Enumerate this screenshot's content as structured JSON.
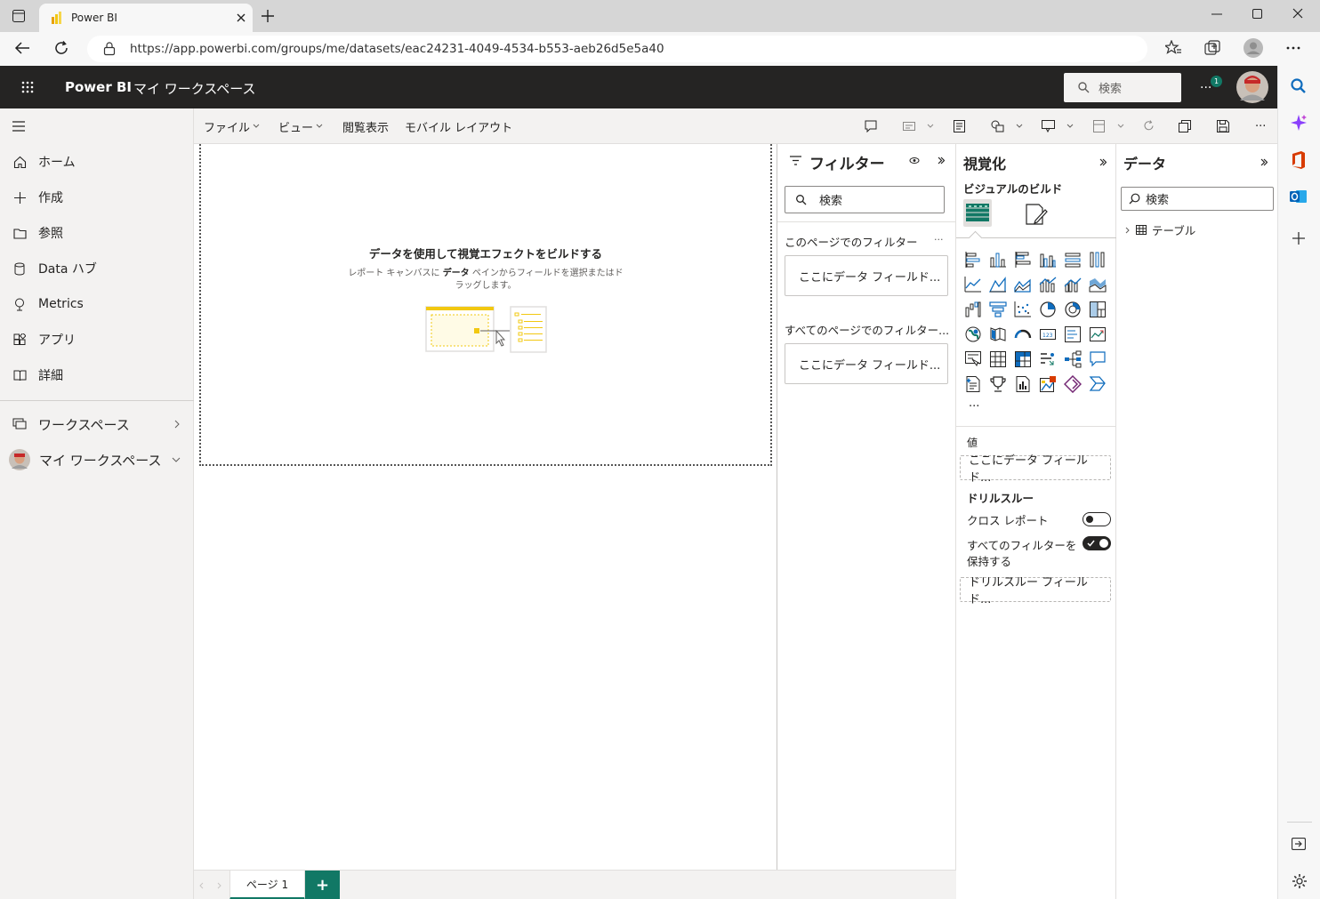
{
  "browser": {
    "tab_title": "Power BI",
    "url": "https://app.powerbi.com/groups/me/datasets/eac24231-4049-4534-b553-aeb26d5e5a40"
  },
  "header": {
    "app_name": "Power BI",
    "workspace": "マイ ワークスペース",
    "search_placeholder": "検索",
    "more": "...",
    "notification_count": "1"
  },
  "nav": {
    "items": [
      {
        "label": "ホーム",
        "icon": "home-icon"
      },
      {
        "label": "作成",
        "icon": "plus-icon"
      },
      {
        "label": "参照",
        "icon": "folder-icon"
      },
      {
        "label": "Data ハブ",
        "icon": "database-icon"
      },
      {
        "label": "Metrics",
        "icon": "trophy-icon"
      },
      {
        "label": "アプリ",
        "icon": "apps-icon"
      },
      {
        "label": "詳細",
        "icon": "book-icon"
      }
    ],
    "workspaces": "ワークスペース",
    "my_workspace": "マイ ワークスペース"
  },
  "ribbon": {
    "file": "ファイル",
    "view": "ビュー",
    "reading": "閲覧表示",
    "mobile": "モバイル レイアウト",
    "more": "..."
  },
  "canvas": {
    "empty_title": "データを使用して視覚エフェクトをビルドする",
    "empty_desc_1": "レポート キャンバスに",
    "empty_desc_bold": "データ",
    "empty_desc_2": "ペインからフィールドを選択またはド",
    "empty_desc_3": "ラッグします。"
  },
  "filters": {
    "title": "フィルター",
    "search_placeholder": "検索",
    "this_page": "このページでのフィルター",
    "this_page_more": "...",
    "this_page_drop": "ここにデータ フィールド...",
    "all_pages": "すべてのページでのフィルター...",
    "all_pages_drop": "ここにデータ フィールド..."
  },
  "visualizations": {
    "title": "視覚化",
    "build_label": "ビジュアルのビルド",
    "more": "...",
    "values_label": "値",
    "values_drop": "ここにデータ フィールド...",
    "drillthrough_label": "ドリルスルー",
    "cross_report": "クロス レポート",
    "cross_report_on": false,
    "keep_filters_1": "すべてのフィルターを",
    "keep_filters_2": "保持する",
    "keep_filters_on": true,
    "drill_drop": "ドリルスルー フィールド..."
  },
  "data_pane": {
    "title": "データ",
    "search_placeholder": "検索",
    "tables": [
      "テーブル"
    ]
  },
  "pages": {
    "tabs": [
      "ページ 1"
    ],
    "add": "+"
  },
  "colors": {
    "header_bg": "#252423",
    "accent_green": "#117865",
    "yellow": "#f2c811"
  }
}
